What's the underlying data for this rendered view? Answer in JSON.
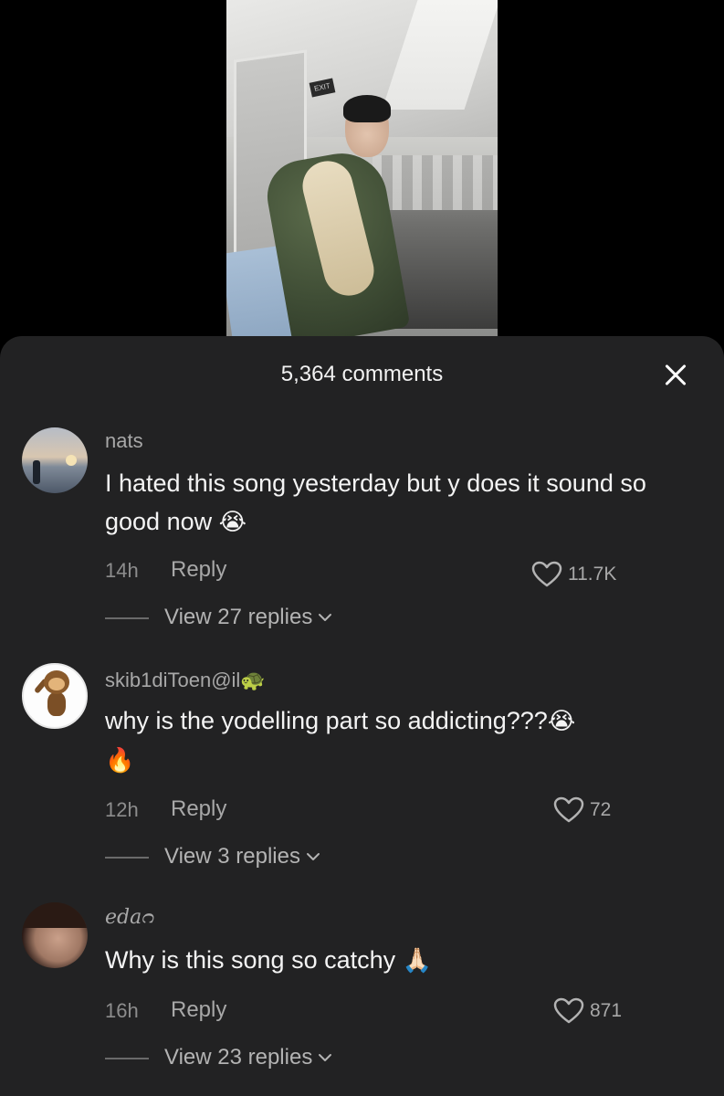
{
  "video": {
    "exit_sign": "EXIT"
  },
  "comments_sheet": {
    "title": "5,364 comments",
    "close_icon": "close-icon"
  },
  "comments": [
    {
      "username": "nats",
      "text": "I hated this song yesterday but y does it sound so good now",
      "emoji": "😭",
      "time": "14h",
      "reply_label": "Reply",
      "likes": "11.7K",
      "view_replies": "View 27 replies"
    },
    {
      "username": "skib1diToen@il🐢",
      "text": "why is the yodelling part so addicting???",
      "emoji": "😭",
      "emoji2": "🔥",
      "time": "12h",
      "reply_label": "Reply",
      "likes": "72",
      "view_replies": "View 3 replies"
    },
    {
      "username": "edaᴒ",
      "text": "Why is this song so catchy",
      "emoji": "🙏🏻",
      "time": "16h",
      "reply_label": "Reply",
      "likes": "871",
      "view_replies": "View 23 replies"
    }
  ],
  "colors": {
    "sheet_bg": "#222223",
    "text": "#f4f4f4",
    "muted": "#a8a8a8"
  }
}
